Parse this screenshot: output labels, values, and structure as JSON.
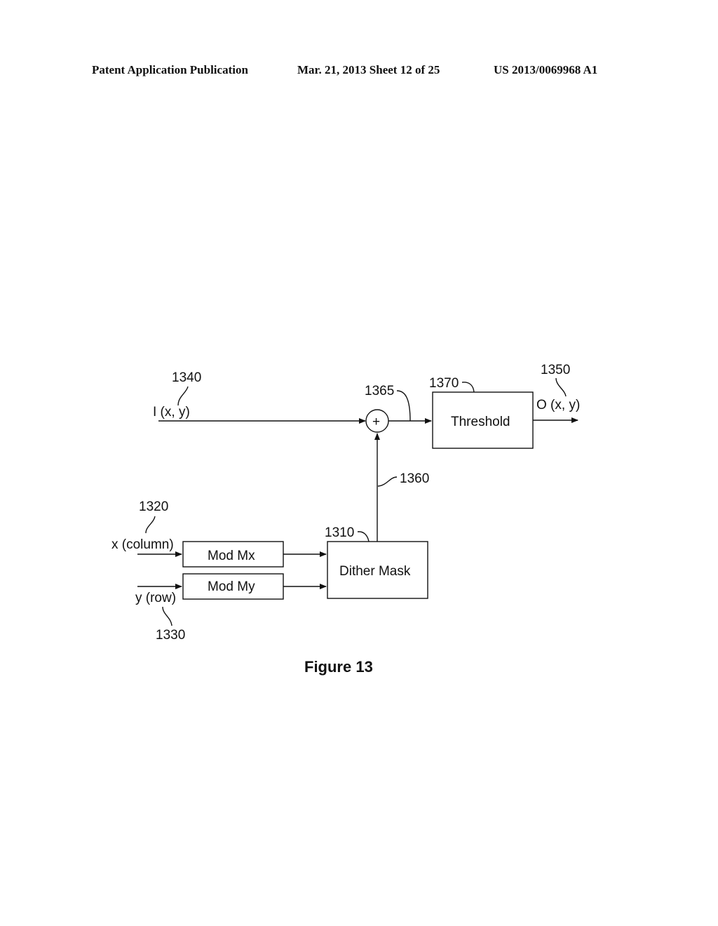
{
  "header": {
    "publication": "Patent Application Publication",
    "date_sheet": "Mar. 21, 2013  Sheet 12 of 25",
    "number": "US 2013/0069968 A1"
  },
  "diagram": {
    "figure_caption": "Figure 13",
    "blocks": {
      "threshold": "Threshold",
      "dither_mask": "Dither Mask",
      "mod_mx": "Mod Mx",
      "mod_my": "Mod My",
      "adder_symbol": "+"
    },
    "signals": {
      "input": "I (x, y)",
      "output": "O (x, y)",
      "x_column": "x (column)",
      "y_row": "y (row)"
    },
    "reference_numerals": {
      "input": "1340",
      "output": "1350",
      "adder": "1365",
      "threshold": "1370",
      "dither_output": "1360",
      "dither_mask": "1310",
      "x_column": "1320",
      "y_row": "1330"
    }
  }
}
